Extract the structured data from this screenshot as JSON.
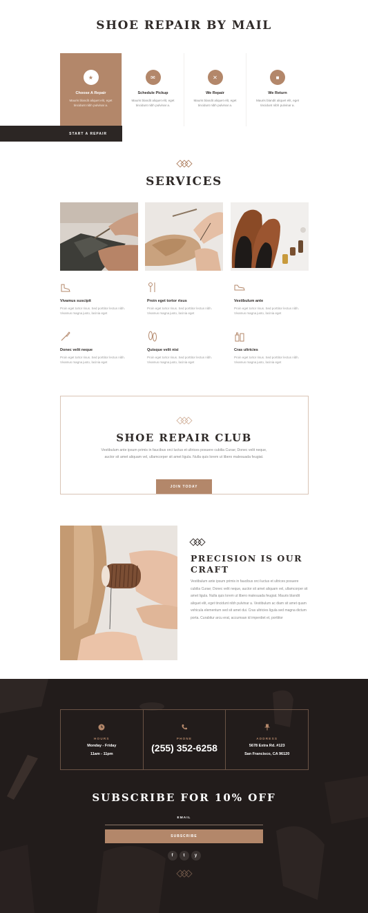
{
  "mail": {
    "title": "SHOE REPAIR BY MAIL",
    "steps": [
      {
        "title": "Choose A Repair",
        "text": "Mauris blandit aliquet elit, eget tincidunt nibh pulvinar a."
      },
      {
        "title": "Schedule Pickup",
        "text": "Mauris blandit aliquet elit, eget tincidunt nibh pulvinar a."
      },
      {
        "title": "We Repair",
        "text": "Mauris blandit aliquet elit, eget tincidunt nibh pulvinar a."
      },
      {
        "title": "We Return",
        "text": "Mauris blandit aliquet elit, eget tincidunt nibh pulvinar a."
      }
    ],
    "start_button": "START A REPAIR"
  },
  "services": {
    "title": "SERVICES",
    "items": [
      {
        "title": "Vivamus suscipit",
        "text": "Proin eget tortor risus. Sed porttitor lectus nibh. Vivamus magna justo, lacinia eget"
      },
      {
        "title": "Proin eget tortor risus",
        "text": "Proin eget tortor risus. Sed porttitor lectus nibh. Vivamus magna justo, lacinia eget"
      },
      {
        "title": "Vestibulum ante",
        "text": "Proin eget tortor risus. Sed porttitor lectus nibh. Vivamus magna justo, lacinia eget"
      },
      {
        "title": "Donec velit neque",
        "text": "Proin eget tortor risus. Sed porttitor lectus nibh. Vivamus magna justo, lacinia eget"
      },
      {
        "title": "Quisque velit nisi",
        "text": "Proin eget tortor risus. Sed porttitor lectus nibh. Vivamus magna justo, lacinia eget"
      },
      {
        "title": "Cras ultricies",
        "text": "Proin eget tortor risus. Sed porttitor lectus nibh. Vivamus magna justo, lacinia eget"
      }
    ]
  },
  "club": {
    "title": "SHOE REPAIR CLUB",
    "text": "Vestibulum ante ipsum primis in faucibus orci luctus et ultrices posuere cubilia Curae; Donec velit neque, auctor sit amet aliquam vel, ullamcorper sit amet ligula. Nulla quis lorem ut libero malesuada feugiat.",
    "button": "JOIN TODAY"
  },
  "precision": {
    "title": "PRECISION IS OUR CRAFT",
    "text": "Vestibulum ante ipsum primis in faucibus orci luctus et ultrices posuere cubilia Curae; Donec velit neque, auctor sit amet aliquam vel, ullamcorper sit amet ligula. Nulla quis lorem ut libero malesuada feugiat. Mauris blandit aliquet elit, eget tincidunt nibh pulvinar a. Vestibulum ac diam sit amet quam vehicula elementum sed sit amet dui. Cras ultricies ligula sed magna dictum porta. Curabitur arcu erat, accumsan id imperdiet et, porttitor"
  },
  "footer": {
    "hours_label": "HOURS",
    "hours_value_1": "Monday - Friday",
    "hours_value_2": "11am - 11pm",
    "phone_label": "PHONE",
    "phone_value": "(255) 352-6258",
    "address_label": "ADDRESS",
    "address_value_1": "5678 Extra Rd. #123",
    "address_value_2": "San Francisco, CA 96120",
    "subscribe_title": "SUBSCRIBE FOR 10% OFF",
    "email_label": "EMAIL",
    "subscribe_button": "SUBSCRIBE",
    "socials": [
      "f",
      "t",
      "y"
    ]
  },
  "colors": {
    "accent": "#b3876a",
    "dark": "#221c1b",
    "heading": "#2f2a28"
  }
}
